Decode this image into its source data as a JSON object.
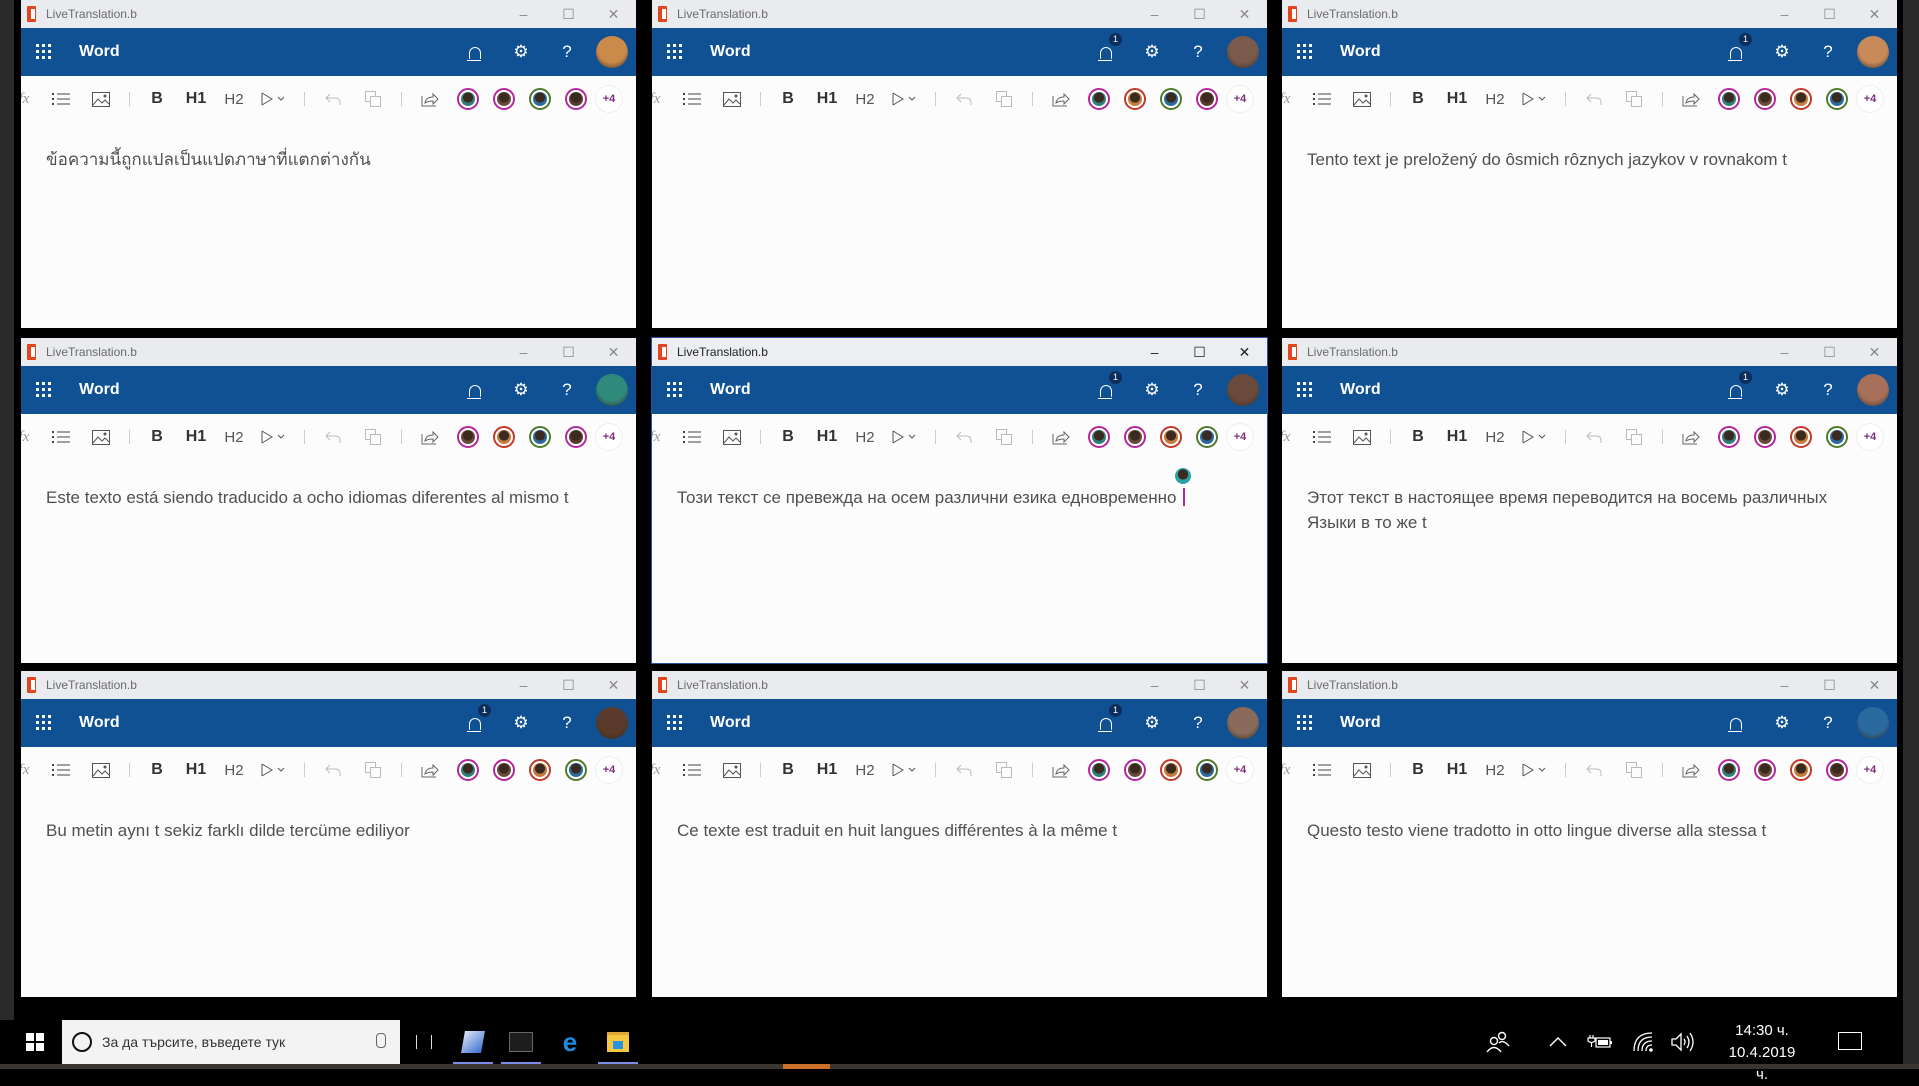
{
  "windows": [
    {
      "title": "LiveTranslation.b",
      "app": "Word",
      "notification_badge": null,
      "user_avatar_color": "#c98a4a",
      "collaborators": [
        {
          "ring": "#b4279b",
          "face": "#2f7e7c"
        },
        {
          "ring": "#b4279b",
          "face": "#6b4a3a"
        },
        {
          "ring": "#4e7a2d",
          "face": "#2b6a9e"
        },
        {
          "ring": "#b4279b",
          "face": "#5a3a2a"
        }
      ],
      "more_collaborators": "+4",
      "text": "ข้อความนี้ถูกแปลเป็นแปดภาษาที่แตกต่างกัน",
      "active": false
    },
    {
      "title": "LiveTranslation.b",
      "app": "Word",
      "notification_badge": "1",
      "user_avatar_color": "#7a5a4a",
      "collaborators": [
        {
          "ring": "#b4279b",
          "face": "#2f7e7c"
        },
        {
          "ring": "#c0392b",
          "face": "#c47a3a"
        },
        {
          "ring": "#4e7a2d",
          "face": "#2b6a9e"
        },
        {
          "ring": "#b4279b",
          "face": "#5a3a2a"
        }
      ],
      "more_collaborators": "+4",
      "text": "",
      "active": false
    },
    {
      "title": "LiveTranslation.b",
      "app": "Word",
      "notification_badge": "1",
      "user_avatar_color": "#c98a5a",
      "collaborators": [
        {
          "ring": "#b4279b",
          "face": "#2f7e7c"
        },
        {
          "ring": "#b4279b",
          "face": "#6b4a3a"
        },
        {
          "ring": "#c0392b",
          "face": "#c47a3a"
        },
        {
          "ring": "#4e7a2d",
          "face": "#2b6a9e"
        }
      ],
      "more_collaborators": "+4",
      "text": "Tento text je preložený do ôsmich rôznych jazykov v rovnakom t",
      "active": false
    },
    {
      "title": "LiveTranslation.b",
      "app": "Word",
      "notification_badge": null,
      "user_avatar_color": "#2f8a7c",
      "collaborators": [
        {
          "ring": "#b4279b",
          "face": "#6b4a3a"
        },
        {
          "ring": "#c0392b",
          "face": "#c47a3a"
        },
        {
          "ring": "#4e7a2d",
          "face": "#2b6a9e"
        },
        {
          "ring": "#b4279b",
          "face": "#5a3a2a"
        }
      ],
      "more_collaborators": "+4",
      "text": "Este texto está siendo traducido a ocho idiomas diferentes al mismo t",
      "active": false
    },
    {
      "title": "LiveTranslation.b",
      "app": "Word",
      "notification_badge": "1",
      "user_avatar_color": "#6a4a3a",
      "collaborators": [
        {
          "ring": "#b4279b",
          "face": "#2f7e7c"
        },
        {
          "ring": "#b4279b",
          "face": "#6b4a3a"
        },
        {
          "ring": "#c0392b",
          "face": "#c47a3a"
        },
        {
          "ring": "#4e7a2d",
          "face": "#2b6a9e"
        }
      ],
      "more_collaborators": "+4",
      "text": "Този текст се превежда на осем различни езика едновременно",
      "active": true
    },
    {
      "title": "LiveTranslation.b",
      "app": "Word",
      "notification_badge": "1",
      "user_avatar_color": "#a6705a",
      "collaborators": [
        {
          "ring": "#b4279b",
          "face": "#2f7e7c"
        },
        {
          "ring": "#b4279b",
          "face": "#6b4a3a"
        },
        {
          "ring": "#c0392b",
          "face": "#c47a3a"
        },
        {
          "ring": "#4e7a2d",
          "face": "#2b6a9e"
        }
      ],
      "more_collaborators": "+4",
      "text": "Этот текст в настоящее время переводится на восемь различных Языки в то же t",
      "active": false
    },
    {
      "title": "LiveTranslation.b",
      "app": "Word",
      "notification_badge": "1",
      "user_avatar_color": "#5a3a2a",
      "collaborators": [
        {
          "ring": "#b4279b",
          "face": "#2f7e7c"
        },
        {
          "ring": "#b4279b",
          "face": "#6b4a3a"
        },
        {
          "ring": "#c0392b",
          "face": "#c47a3a"
        },
        {
          "ring": "#4e7a2d",
          "face": "#2b6a9e"
        }
      ],
      "more_collaborators": "+4",
      "text": "Bu metin aynı t sekiz farklı dilde tercüme ediliyor",
      "active": false
    },
    {
      "title": "LiveTranslation.b",
      "app": "Word",
      "notification_badge": "1",
      "user_avatar_color": "#8a6a5a",
      "collaborators": [
        {
          "ring": "#b4279b",
          "face": "#2f7e7c"
        },
        {
          "ring": "#b4279b",
          "face": "#6b4a3a"
        },
        {
          "ring": "#c0392b",
          "face": "#c47a3a"
        },
        {
          "ring": "#4e7a2d",
          "face": "#2b6a9e"
        }
      ],
      "more_collaborators": "+4",
      "text": "Ce texte est traduit en huit langues différentes à la même t",
      "active": false
    },
    {
      "title": "LiveTranslation.b",
      "app": "Word",
      "notification_badge": null,
      "user_avatar_color": "#2b6a9e",
      "collaborators": [
        {
          "ring": "#b4279b",
          "face": "#2f7e7c"
        },
        {
          "ring": "#b4279b",
          "face": "#6b4a3a"
        },
        {
          "ring": "#c0392b",
          "face": "#c47a3a"
        },
        {
          "ring": "#b4279b",
          "face": "#5a3a2a"
        }
      ],
      "more_collaborators": "+4",
      "text": "Questo testo viene tradotto in otto lingue diverse alla stessa t",
      "active": false
    }
  ],
  "toolbar": {
    "fx": "fx",
    "bold": "B",
    "h1": "H1",
    "h2": "H2",
    "minimize": "–",
    "maximize": "☐",
    "close": "✕",
    "help": "?",
    "settings": "⚙"
  },
  "taskbar": {
    "search_placeholder": "За да търсите, въведете тук",
    "apps": [
      "task-view",
      "notepad-app",
      "console-app",
      "edge-browser",
      "file-explorer"
    ],
    "time": "14:30 ч.",
    "date": "10.4.2019 ч."
  },
  "colors": {
    "appbar": "#0f5193",
    "titlebar": "#e9ebee",
    "office_brand": "#e2451e"
  }
}
